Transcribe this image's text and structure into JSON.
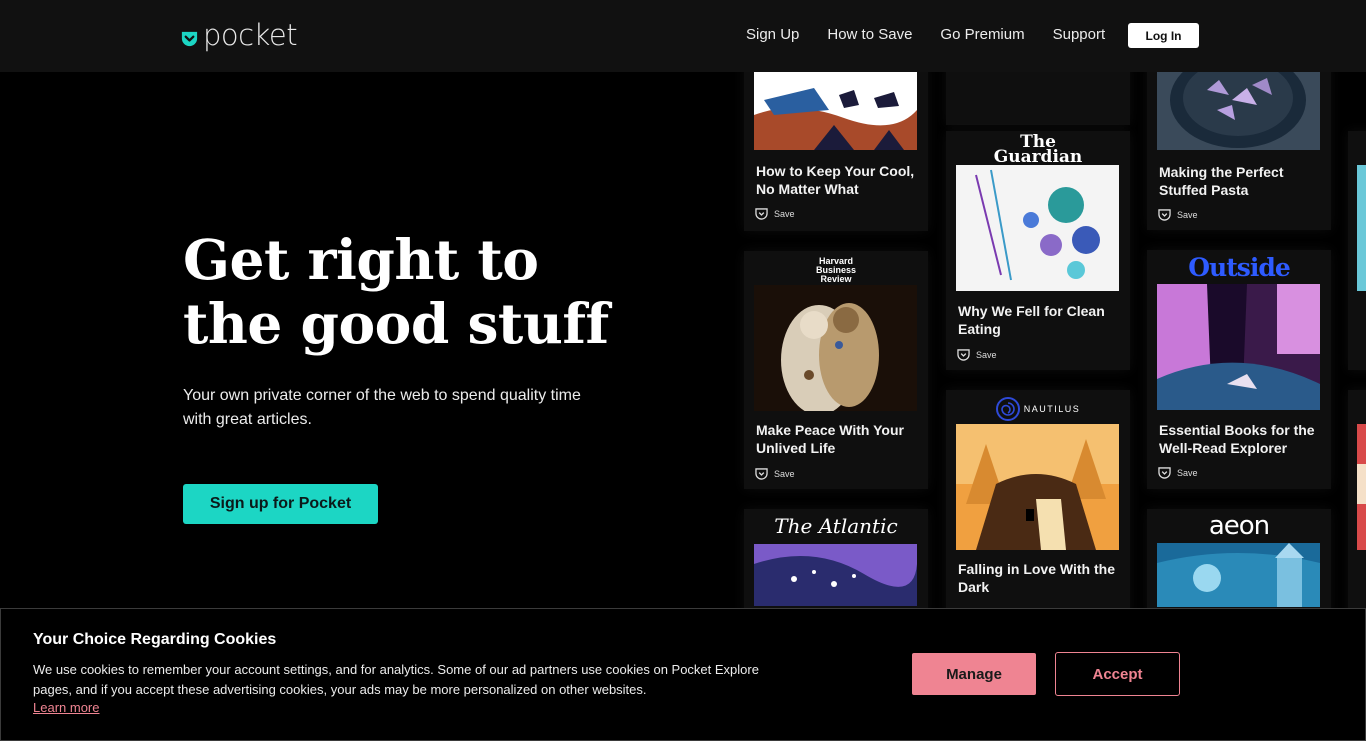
{
  "header": {
    "logo_text": "pocket",
    "nav": [
      "Sign Up",
      "How to Save",
      "Go Premium",
      "Support"
    ],
    "login_label": "Log In"
  },
  "hero": {
    "title_line1": "Get right to",
    "title_line2": "the good stuff",
    "subtitle": "Your own private corner of the web to spend quality time with great articles.",
    "cta_label": "Sign up for Pocket"
  },
  "cards": [
    {
      "publisher": "",
      "title": "How to Keep Your Cool, No Matter What",
      "save": "Save"
    },
    {
      "publisher": "Harvard Business Review",
      "title": "Make Peace With Your Unlived Life",
      "save": "Save"
    },
    {
      "publisher": "The Atlantic",
      "title": "",
      "save": ""
    },
    {
      "publisher": "The Guardian",
      "title": "Why We Fell for Clean Eating",
      "save": "Save"
    },
    {
      "publisher": "NAUTILUS",
      "title": "Falling in Love With the Dark",
      "save": ""
    },
    {
      "publisher": "",
      "title": "Making the Perfect Stuffed Pasta",
      "save": "Save"
    },
    {
      "publisher": "Outside",
      "title": "Essential Books for the Well-Read Explorer",
      "save": "Save"
    },
    {
      "publisher": "aeon",
      "title": "",
      "save": ""
    }
  ],
  "cookie": {
    "title": "Your Choice Regarding Cookies",
    "text": "We use cookies to remember your account settings, and for analytics. Some of our ad partners use cookies on Pocket Explore pages, and if you accept these advertising cookies, your ads may be more personalized on other websites.",
    "link": "Learn more",
    "manage_label": "Manage",
    "accept_label": "Accept"
  },
  "colors": {
    "accent_teal": "#1cd6c4",
    "cookie_pink": "#ef8492",
    "header_bg": "#111111",
    "page_bg": "#000000"
  }
}
